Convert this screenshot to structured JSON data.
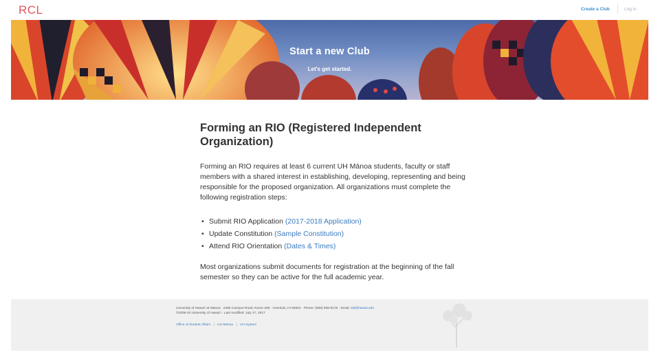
{
  "header": {
    "brand": "RCL",
    "nav": {
      "create_club": "Create a Club",
      "login": "Log in"
    }
  },
  "hero": {
    "title": "Start a new Club",
    "subtitle": "Let's get started."
  },
  "main": {
    "heading": "Forming an RIO (Registered Independent Organization)",
    "intro": "Forming an RIO requires at least 6 current UH Mānoa students, faculty or staff members with a shared interest in establishing, developing, representing and being responsible for the proposed organization. All organizations must complete the following registration steps:",
    "steps": [
      {
        "text": "Submit RIO Application ",
        "link": "(2017-2018 Application)"
      },
      {
        "text": "Update Constitution ",
        "link": "(Sample Constitution)"
      },
      {
        "text": "Attend RIO Orientation ",
        "link": "(Dates & Times)"
      }
    ],
    "closing": "Most organizations submit documents for registration at the beginning of the fall semester so they can be active for the full academic year."
  },
  "footer": {
    "address": "University of Hawaiʻi at Mānoa · 2465 Campus Road, Room 208 · Honolulu, HI 96822 · Phone: (808) 956-8178 · Email: ",
    "email": "sld@hawaii.edu",
    "copyright": "©2009-10 University of Hawaiʻi · Last modified: July 17, 2017",
    "links": [
      "Office of Student Affairs",
      "UH Mānoa",
      "UH System"
    ],
    "link_separator": "|"
  },
  "colors": {
    "brand": "#e0555f",
    "link": "#3b7bbf",
    "nav_link": "#3b8fd1",
    "footer_bg": "#f0f0f0"
  }
}
